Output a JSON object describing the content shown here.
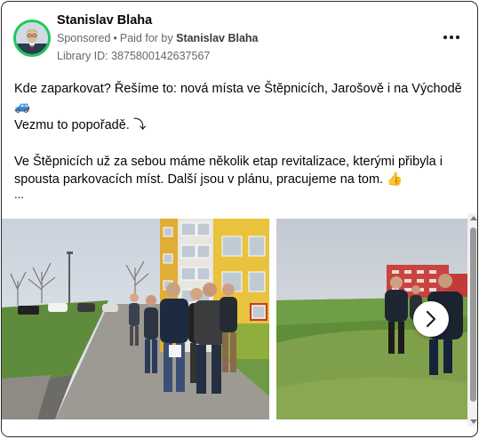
{
  "post": {
    "author": "Stanislav Blaha",
    "sponsored_label": "Sponsored",
    "paid_for_prefix": "Paid for by",
    "paid_for_name": "Stanislav Blaha",
    "library_id": "Library ID: 3875800142637567",
    "text_line1": "Kde zaparkovat? Řešíme to: nová místa ve Štěpnicích, Jarošově i na Východě 🚙",
    "text_line2": "Vezmu to popořadě. ⤵",
    "text_line3": "Ve Štěpnicích už za sebou máme několik etap revitalizace, kterými přibyla i spousta parkovacích míst. Další jsou v plánu, pracujeme na tom. 👍",
    "text_more": "..."
  },
  "icons": {
    "more": "more-options-icon",
    "next": "chevron-right-icon"
  },
  "colors": {
    "avatar_ring": "#22c55e",
    "meta_text": "#65676b",
    "building_yellow": "#e9c23e",
    "building_red": "#c9433f"
  }
}
